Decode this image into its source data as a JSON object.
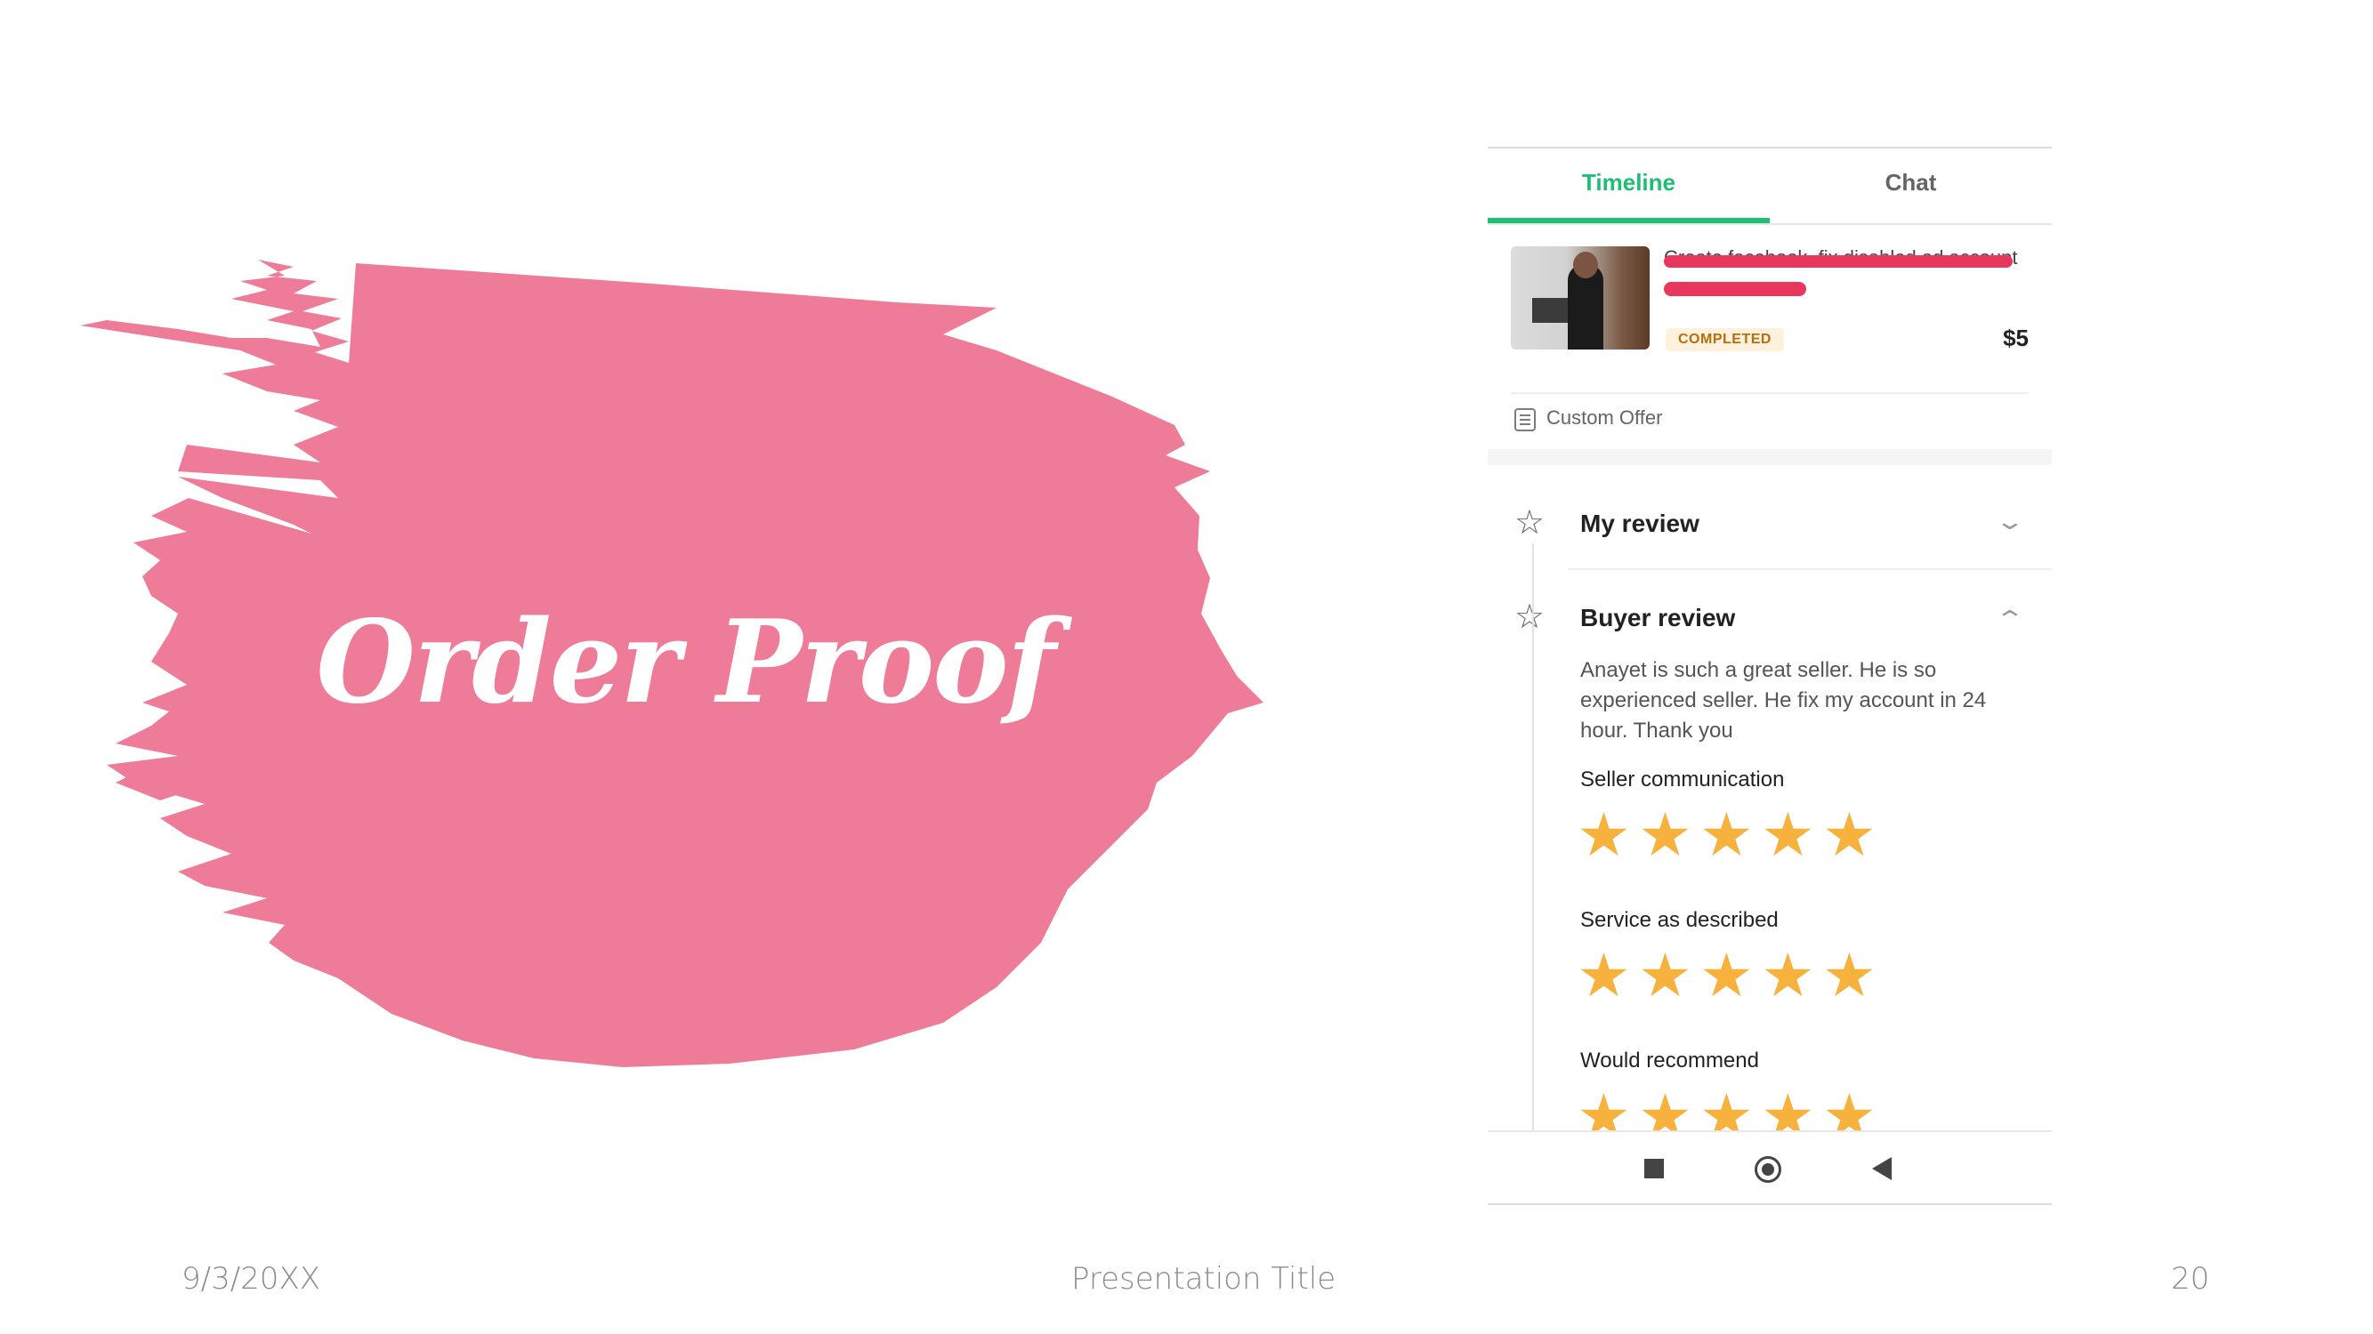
{
  "slide": {
    "title": "Order Proof",
    "footer_date": "9/3/20XX",
    "footer_title": "Presentation Title",
    "footer_page": "20"
  },
  "colors": {
    "splash": "#ee7b97",
    "accent_green": "#1dbf73",
    "star": "#f6b23c",
    "redaction": "#e8365d"
  },
  "phone": {
    "tabs": [
      {
        "label": "Timeline",
        "active": true
      },
      {
        "label": "Chat",
        "active": false
      }
    ],
    "order": {
      "title": "Create facebook, fix disabled ad account",
      "status": "COMPLETED",
      "price": "$5"
    },
    "custom_offer_label": "Custom Offer",
    "my_review": {
      "label": "My review",
      "expanded": false
    },
    "buyer_review": {
      "label": "Buyer review",
      "expanded": true,
      "text": "Anayet is such a great seller. He is so experienced seller. He fix my account in 24 hour. Thank you",
      "ratings": [
        {
          "label": "Seller communication",
          "stars": 5
        },
        {
          "label": "Service as described",
          "stars": 5
        },
        {
          "label": "Would recommend",
          "stars": 5
        }
      ]
    },
    "nav_icons": [
      "recent-apps-icon",
      "home-icon",
      "back-icon"
    ]
  }
}
